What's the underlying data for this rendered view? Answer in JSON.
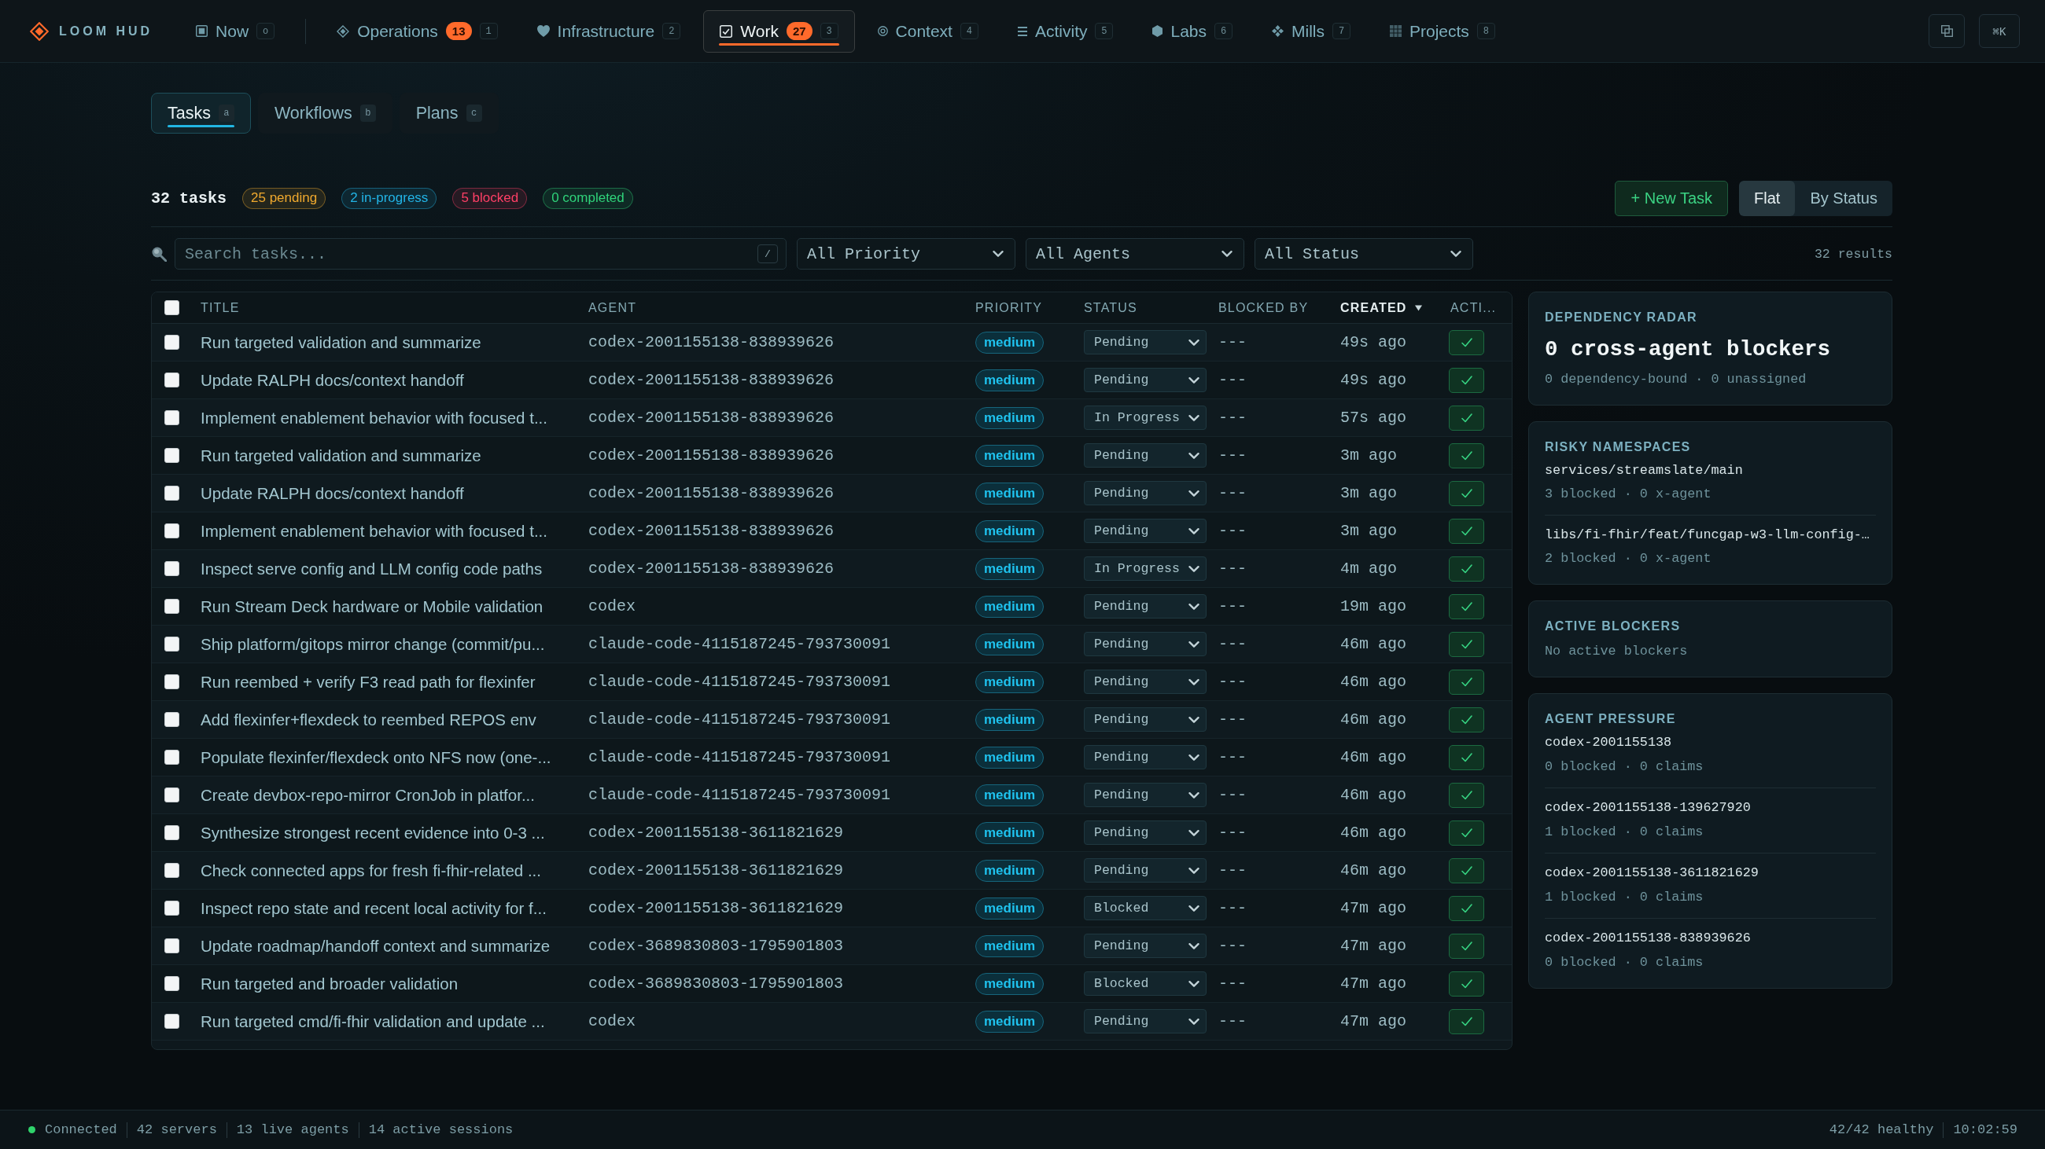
{
  "brand": {
    "name": "LOOM HUD"
  },
  "nav": {
    "pinned": [
      {
        "label": "Now",
        "shortcut": "o",
        "selected": false
      }
    ],
    "items": [
      {
        "label": "Operations",
        "count": "13",
        "shortcut": "1",
        "selected": false
      },
      {
        "label": "Infrastructure",
        "shortcut": "2",
        "selected": false
      },
      {
        "label": "Work",
        "count": "27",
        "shortcut": "3",
        "selected": true
      },
      {
        "label": "Context",
        "shortcut": "4",
        "selected": false
      },
      {
        "label": "Activity",
        "shortcut": "5",
        "selected": false
      },
      {
        "label": "Labs",
        "shortcut": "6",
        "selected": false
      },
      {
        "label": "Mills",
        "shortcut": "7",
        "selected": false
      },
      {
        "label": "Projects",
        "shortcut": "8",
        "selected": false
      }
    ],
    "command_button": "⌘K"
  },
  "tabs": [
    {
      "label": "Tasks",
      "shortcut": "a",
      "selected": true
    },
    {
      "label": "Workflows",
      "shortcut": "b",
      "selected": false
    },
    {
      "label": "Plans",
      "shortcut": "c",
      "selected": false
    }
  ],
  "summary": {
    "total": "32 tasks",
    "badges": [
      {
        "label": "25 pending",
        "color": "#f0a92e"
      },
      {
        "label": "2 in-progress",
        "color": "#22b4e6"
      },
      {
        "label": "5 blocked",
        "color": "#ff3f66"
      },
      {
        "label": "0 completed",
        "color": "#2fd37a"
      }
    ]
  },
  "new_task_button": "+ New Task",
  "view_toggle": [
    {
      "label": "Flat",
      "selected": true
    },
    {
      "label": "By Status",
      "selected": false
    }
  ],
  "filters": {
    "search": {
      "placeholder": "Search tasks...",
      "shortcut": "/"
    },
    "selects": [
      {
        "value": "All Priority"
      },
      {
        "value": "All Agents"
      },
      {
        "value": "All Status"
      }
    ],
    "results": "32 results"
  },
  "table": {
    "select_all": {
      "checked": false
    },
    "columns": [
      {
        "label": "TITLE",
        "sorted": false
      },
      {
        "label": "AGENT",
        "sorted": false
      },
      {
        "label": "PRIORITY",
        "sorted": false
      },
      {
        "label": "STATUS",
        "sorted": false
      },
      {
        "label": "BLOCKED BY",
        "sorted": false
      },
      {
        "label": "CREATED",
        "sorted": true
      },
      {
        "label": "ACTI...",
        "sorted": false
      }
    ],
    "rows": [
      {
        "checked": false,
        "title": "Run targeted validation and summarize",
        "agent": "codex-2001155138-838939626",
        "priority": "medium",
        "status": "Pending",
        "blocked_by": "---",
        "created": "49s ago"
      },
      {
        "checked": false,
        "title": "Update RALPH docs/context handoff",
        "agent": "codex-2001155138-838939626",
        "priority": "medium",
        "status": "Pending",
        "blocked_by": "---",
        "created": "49s ago"
      },
      {
        "checked": false,
        "title": "Implement enablement behavior with focused t...",
        "agent": "codex-2001155138-838939626",
        "priority": "medium",
        "status": "In Progress",
        "blocked_by": "---",
        "created": "57s ago"
      },
      {
        "checked": false,
        "title": "Run targeted validation and summarize",
        "agent": "codex-2001155138-838939626",
        "priority": "medium",
        "status": "Pending",
        "blocked_by": "---",
        "created": "3m ago"
      },
      {
        "checked": false,
        "title": "Update RALPH docs/context handoff",
        "agent": "codex-2001155138-838939626",
        "priority": "medium",
        "status": "Pending",
        "blocked_by": "---",
        "created": "3m ago"
      },
      {
        "checked": false,
        "title": "Implement enablement behavior with focused t...",
        "agent": "codex-2001155138-838939626",
        "priority": "medium",
        "status": "Pending",
        "blocked_by": "---",
        "created": "3m ago"
      },
      {
        "checked": false,
        "title": "Inspect serve config and LLM config code paths",
        "agent": "codex-2001155138-838939626",
        "priority": "medium",
        "status": "In Progress",
        "blocked_by": "---",
        "created": "4m ago"
      },
      {
        "checked": false,
        "title": "Run Stream Deck hardware or Mobile validation",
        "agent": "codex",
        "priority": "medium",
        "status": "Pending",
        "blocked_by": "---",
        "created": "19m ago"
      },
      {
        "checked": false,
        "title": "Ship platform/gitops mirror change (commit/pu...",
        "agent": "claude-code-4115187245-793730091",
        "priority": "medium",
        "status": "Pending",
        "blocked_by": "---",
        "created": "46m ago"
      },
      {
        "checked": false,
        "title": "Run reembed + verify F3 read path for flexinfer",
        "agent": "claude-code-4115187245-793730091",
        "priority": "medium",
        "status": "Pending",
        "blocked_by": "---",
        "created": "46m ago"
      },
      {
        "checked": false,
        "title": "Add flexinfer+flexdeck to reembed REPOS env",
        "agent": "claude-code-4115187245-793730091",
        "priority": "medium",
        "status": "Pending",
        "blocked_by": "---",
        "created": "46m ago"
      },
      {
        "checked": false,
        "title": "Populate flexinfer/flexdeck onto NFS now (one-...",
        "agent": "claude-code-4115187245-793730091",
        "priority": "medium",
        "status": "Pending",
        "blocked_by": "---",
        "created": "46m ago"
      },
      {
        "checked": false,
        "title": "Create devbox-repo-mirror CronJob in platfor...",
        "agent": "claude-code-4115187245-793730091",
        "priority": "medium",
        "status": "Pending",
        "blocked_by": "---",
        "created": "46m ago"
      },
      {
        "checked": false,
        "title": "Synthesize strongest recent evidence into 0-3 ...",
        "agent": "codex-2001155138-3611821629",
        "priority": "medium",
        "status": "Pending",
        "blocked_by": "---",
        "created": "46m ago"
      },
      {
        "checked": false,
        "title": "Check connected apps for fresh fi-fhir-related ...",
        "agent": "codex-2001155138-3611821629",
        "priority": "medium",
        "status": "Pending",
        "blocked_by": "---",
        "created": "46m ago"
      },
      {
        "checked": false,
        "title": "Inspect repo state and recent local activity for f...",
        "agent": "codex-2001155138-3611821629",
        "priority": "medium",
        "status": "Blocked",
        "blocked_by": "---",
        "created": "47m ago"
      },
      {
        "checked": false,
        "title": "Update roadmap/handoff context and summarize",
        "agent": "codex-3689830803-1795901803",
        "priority": "medium",
        "status": "Pending",
        "blocked_by": "---",
        "created": "47m ago"
      },
      {
        "checked": false,
        "title": "Run targeted and broader validation",
        "agent": "codex-3689830803-1795901803",
        "priority": "medium",
        "status": "Blocked",
        "blocked_by": "---",
        "created": "47m ago"
      },
      {
        "checked": false,
        "title": "Run targeted cmd/fi-fhir validation and update ...",
        "agent": "codex",
        "priority": "medium",
        "status": "Pending",
        "blocked_by": "---",
        "created": "47m ago"
      }
    ]
  },
  "sidebar": {
    "radar": {
      "title": "DEPENDENCY RADAR",
      "headline": "0 cross-agent blockers",
      "detail": "0 dependency-bound · 0 unassigned"
    },
    "namespaces": {
      "title": "RISKY NAMESPACES",
      "items": [
        {
          "name": "services/streamslate/main",
          "detail": "3 blocked · 0 x-agent"
        },
        {
          "name": "libs/fi-fhir/feat/funcgap-w3-llm-config-…",
          "detail": "2 blocked · 0 x-agent"
        }
      ]
    },
    "blockers": {
      "title": "ACTIVE BLOCKERS",
      "empty": "No active blockers"
    },
    "pressure": {
      "title": "AGENT PRESSURE",
      "items": [
        {
          "name": "codex-2001155138",
          "detail": "0 blocked · 0 claims"
        },
        {
          "name": "codex-2001155138-139627920",
          "detail": "1 blocked · 0 claims"
        },
        {
          "name": "codex-2001155138-3611821629",
          "detail": "1 blocked · 0 claims"
        },
        {
          "name": "codex-2001155138-838939626",
          "detail": "0 blocked · 0 claims"
        }
      ]
    }
  },
  "status_bar": {
    "connection": {
      "connected": true,
      "label": "Connected"
    },
    "stats": [
      "42 servers",
      "13 live agents",
      "14 active sessions"
    ],
    "right": [
      "42/42 healthy",
      "10:02:59"
    ]
  }
}
